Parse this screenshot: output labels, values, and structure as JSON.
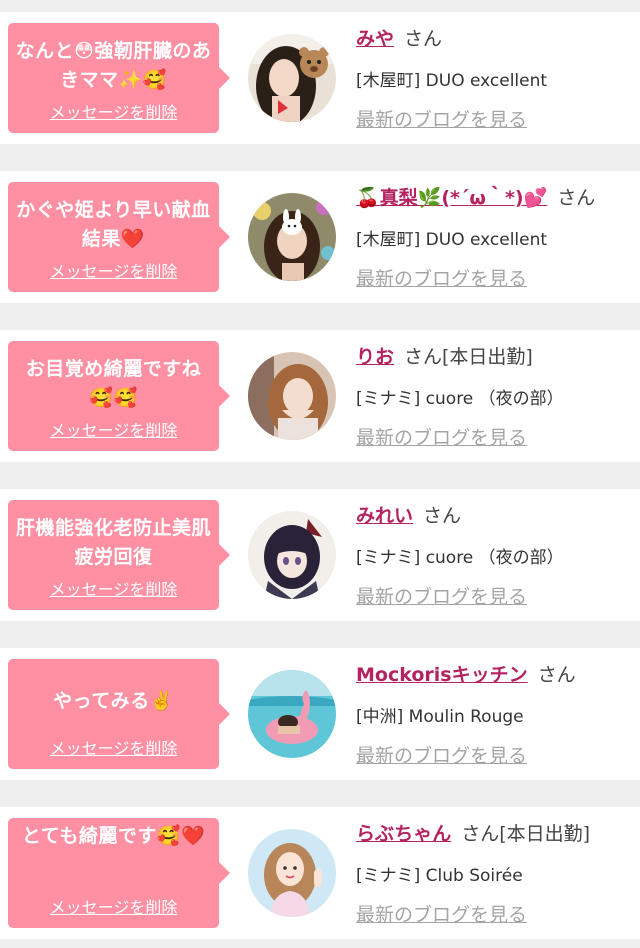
{
  "colors": {
    "background": "#efefef",
    "card": "#ffffff",
    "bubble": "#ff8fa2",
    "name_link": "#b4235f",
    "blog_link": "#a4a4a4"
  },
  "entries": [
    {
      "message": "なんと😳強靭肝臓のあきママ✨🥰",
      "delete_label": "メッセージを削除",
      "name": "みや",
      "honorific": "さん",
      "shop": "[木屋町] DUO excellent",
      "blog_label": "最新のブログを見る",
      "avatar_icon": "woman-with-bear-sticker-avatar"
    },
    {
      "message": "かぐや姫より早い献血結果❤️",
      "delete_label": "メッセージを削除",
      "name": "🍒真梨🌿(*´ω｀*)💕",
      "honorific": "さん",
      "shop": "[木屋町] DUO excellent",
      "blog_label": "最新のブログを見る",
      "avatar_icon": "woman-with-bunny-sticker-avatar"
    },
    {
      "message": "お目覚め綺麗ですね🥰🥰",
      "delete_label": "メッセージを削除",
      "name": "りお",
      "honorific": "さん[本日出勤]",
      "shop": "[ミナミ] cuore （夜の部）",
      "blog_label": "最新のブログを見る",
      "avatar_icon": "woman-portrait-avatar"
    },
    {
      "message": "肝機能強化老防止美肌疲労回復",
      "delete_label": "メッセージを削除",
      "name": "みれい",
      "honorific": "さん",
      "shop": "[ミナミ] cuore （夜の部）",
      "blog_label": "最新のブログを見る",
      "avatar_icon": "anime-character-avatar"
    },
    {
      "message": "やってみる✌️",
      "delete_label": "メッセージを削除",
      "name": "Mockorisキッチン",
      "honorific": "さん",
      "shop": "[中洲] Moulin Rouge",
      "blog_label": "最新のブログを見る",
      "avatar_icon": "pool-flamingo-float-avatar"
    },
    {
      "message": "とても綺麗です🥰❤️",
      "delete_label": "メッセージを削除",
      "name": "らぶちゃん",
      "honorific": "さん[本日出勤]",
      "shop": "[ミナミ] Club Soirée",
      "blog_label": "最新のブログを見る",
      "avatar_icon": "cartoon-woman-avatar"
    }
  ]
}
